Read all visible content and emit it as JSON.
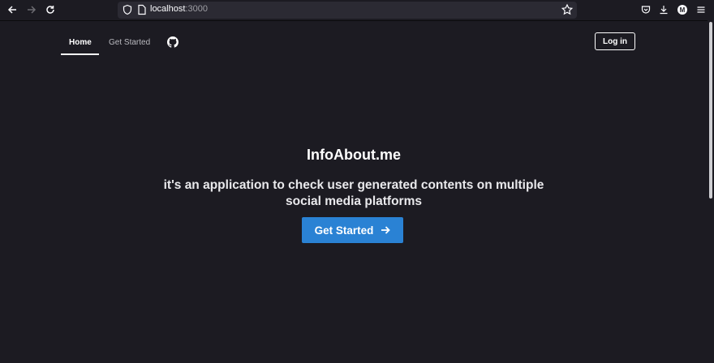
{
  "browser": {
    "url_host": "localhost",
    "url_port": ":3000",
    "back_icon": "arrow-left-icon",
    "forward_icon": "arrow-right-icon",
    "reload_icon": "reload-icon",
    "avatar_letter": "M"
  },
  "nav": {
    "home_label": "Home",
    "get_started_label": "Get Started",
    "github_icon": "github-icon",
    "login_label": "Log in"
  },
  "hero": {
    "title": "InfoAbout.me",
    "subtitle": "it's an application to check user generated contents on multiple social media platforms",
    "cta_label": "Get Started"
  },
  "colors": {
    "background": "#1c1b22",
    "accent": "#2a82d4"
  }
}
